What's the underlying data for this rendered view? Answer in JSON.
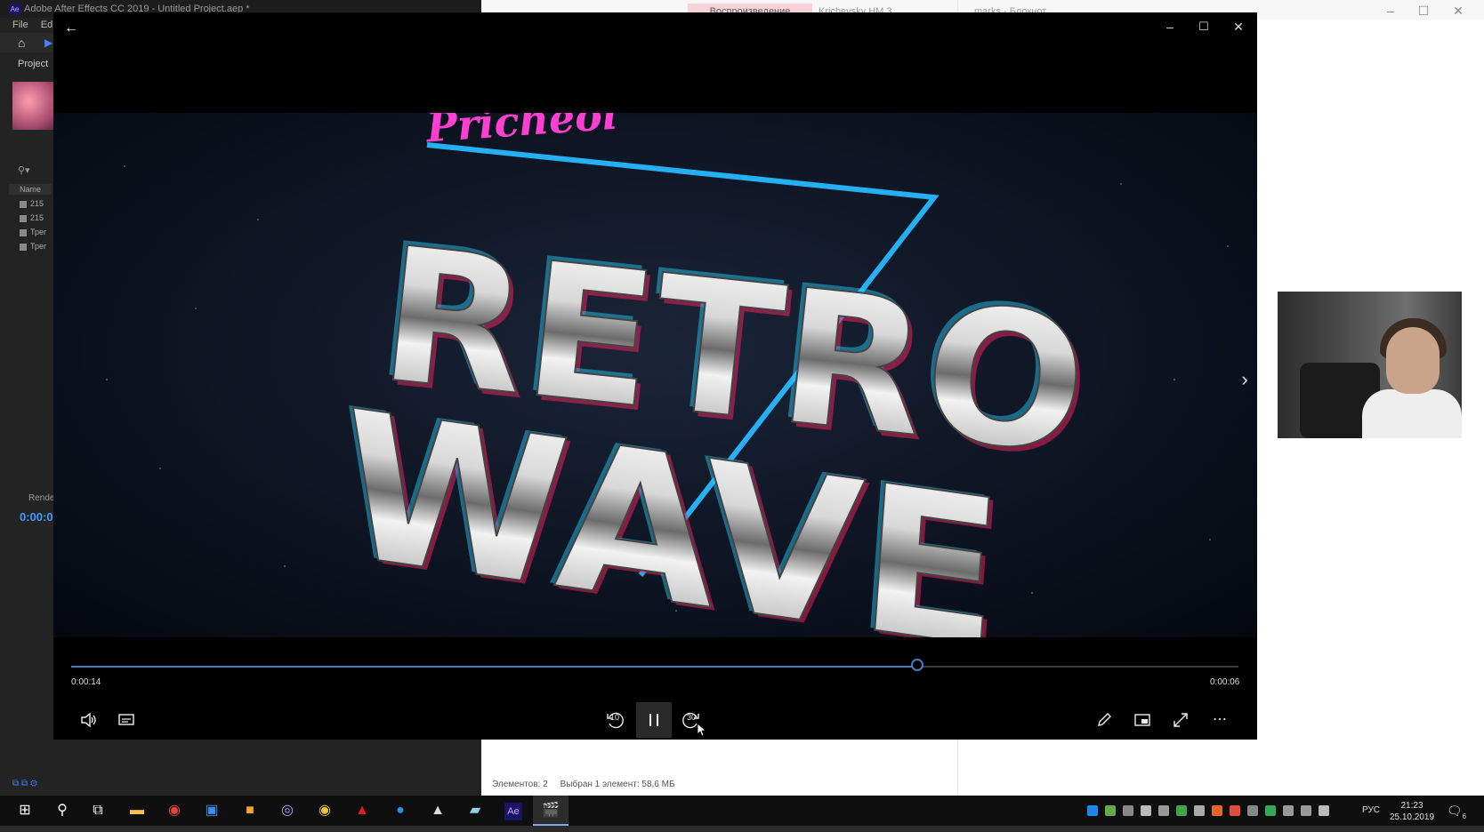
{
  "background_apps": {
    "after_effects": {
      "title": "Adobe After Effects CC 2019 - Untitled Project.aep *",
      "menu": [
        "File",
        "Edit"
      ],
      "project_panel_label": "Project",
      "name_column": "Name",
      "items": [
        "215",
        "215",
        "Трег",
        "Трег"
      ],
      "render_label": "Rende",
      "timecode": "0:00:0"
    },
    "explorer": {
      "active_tab": "Воспроизведение",
      "other_tab": "Krichevsky HM 3",
      "right_window_title": "marks - Блокнот",
      "status_items_count": "Элементов: 2",
      "status_selected": "Выбран 1 элемент: 58,6 МБ"
    }
  },
  "player": {
    "elapsed": "0:00:14",
    "remaining": "0:00:06",
    "progress": 0.725,
    "video_title_line1": "RETRO",
    "video_title_line2": "WAVE",
    "video_script": "Pricheol",
    "controls": {
      "back_skip": "10",
      "forward_skip": "30"
    }
  },
  "taskbar": {
    "apps": [
      "start-icon",
      "search-icon",
      "task-view-icon",
      "file-explorer-icon",
      "chrome-icon",
      "save-icon",
      "sticky-icon",
      "obs-icon",
      "chrome-canary-icon",
      "acrobat-icon",
      "edge-icon",
      "photos-icon",
      "notes-icon",
      "after-effects-icon",
      "movies-tv-icon"
    ],
    "ae_label": "Ae",
    "language": "РУС",
    "time": "21:23",
    "date": "25.10.2019",
    "notification_count": "6"
  },
  "colors": {
    "accent": "#4a7cc3",
    "neon_pink": "#ff3fd2",
    "neon_cyan": "#28b8ff"
  }
}
